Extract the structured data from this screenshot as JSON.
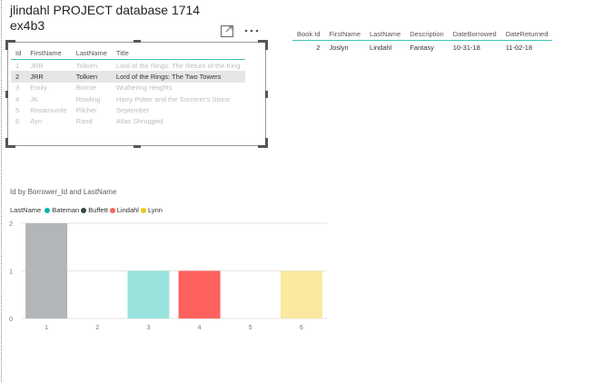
{
  "page": {
    "title_line1": "jlindahl PROJECT database 1714",
    "title_line2": "ex4b3"
  },
  "table1": {
    "columns": [
      "Id",
      "FirstName",
      "LastName",
      "Title"
    ],
    "rows": [
      [
        "1",
        "JRR",
        "Tolkien",
        "Lord of the Rings: The Return of the King"
      ],
      [
        "2",
        "JRR",
        "Tolkien",
        "Lord of the Rings: The Two Towers"
      ],
      [
        "3",
        "Emily",
        "Bronte",
        "Wuthering Heights"
      ],
      [
        "4",
        "JK",
        "Rowling",
        "Harry Potter and the Sorcerer's Stone"
      ],
      [
        "5",
        "Rosamunde",
        "Pilcher",
        "September"
      ],
      [
        "6",
        "Ayn",
        "Rand",
        "Atlas Shrugged"
      ]
    ],
    "selected_row": 2
  },
  "table2": {
    "columns": [
      "Book Id",
      "FirstName",
      "LastName",
      "Description",
      "DateBorrowed",
      "DateReturned"
    ],
    "rows": [
      [
        "2",
        "Joslyn",
        "Lindahl",
        "Fantasy",
        "10-31-18",
        "11-02-18"
      ]
    ]
  },
  "icons": {
    "focus": "focus-mode-icon",
    "more": "more-options-icon"
  },
  "chart_data": {
    "type": "bar",
    "title": "Id by Borrower_Id and LastName",
    "legend_title": "LastName",
    "legend": [
      {
        "name": "Bateman",
        "color": "#01b8aa"
      },
      {
        "name": "Buffett",
        "color": "#374649"
      },
      {
        "name": "Lindahl",
        "color": "#fd625e"
      },
      {
        "name": "Lynn",
        "color": "#f2c80f"
      }
    ],
    "categories": [
      "1",
      "2",
      "3",
      "4",
      "5",
      "6"
    ],
    "values": [
      2,
      0,
      1,
      1,
      0,
      1
    ],
    "bar_colors": [
      "#b3b6b8",
      "#ffffff",
      "#99e3dd",
      "#fd625e",
      "#ffffff",
      "#fae99f"
    ],
    "y_ticks": [
      "0",
      "1",
      "2"
    ],
    "ylim": [
      0,
      2
    ],
    "grid": true
  }
}
